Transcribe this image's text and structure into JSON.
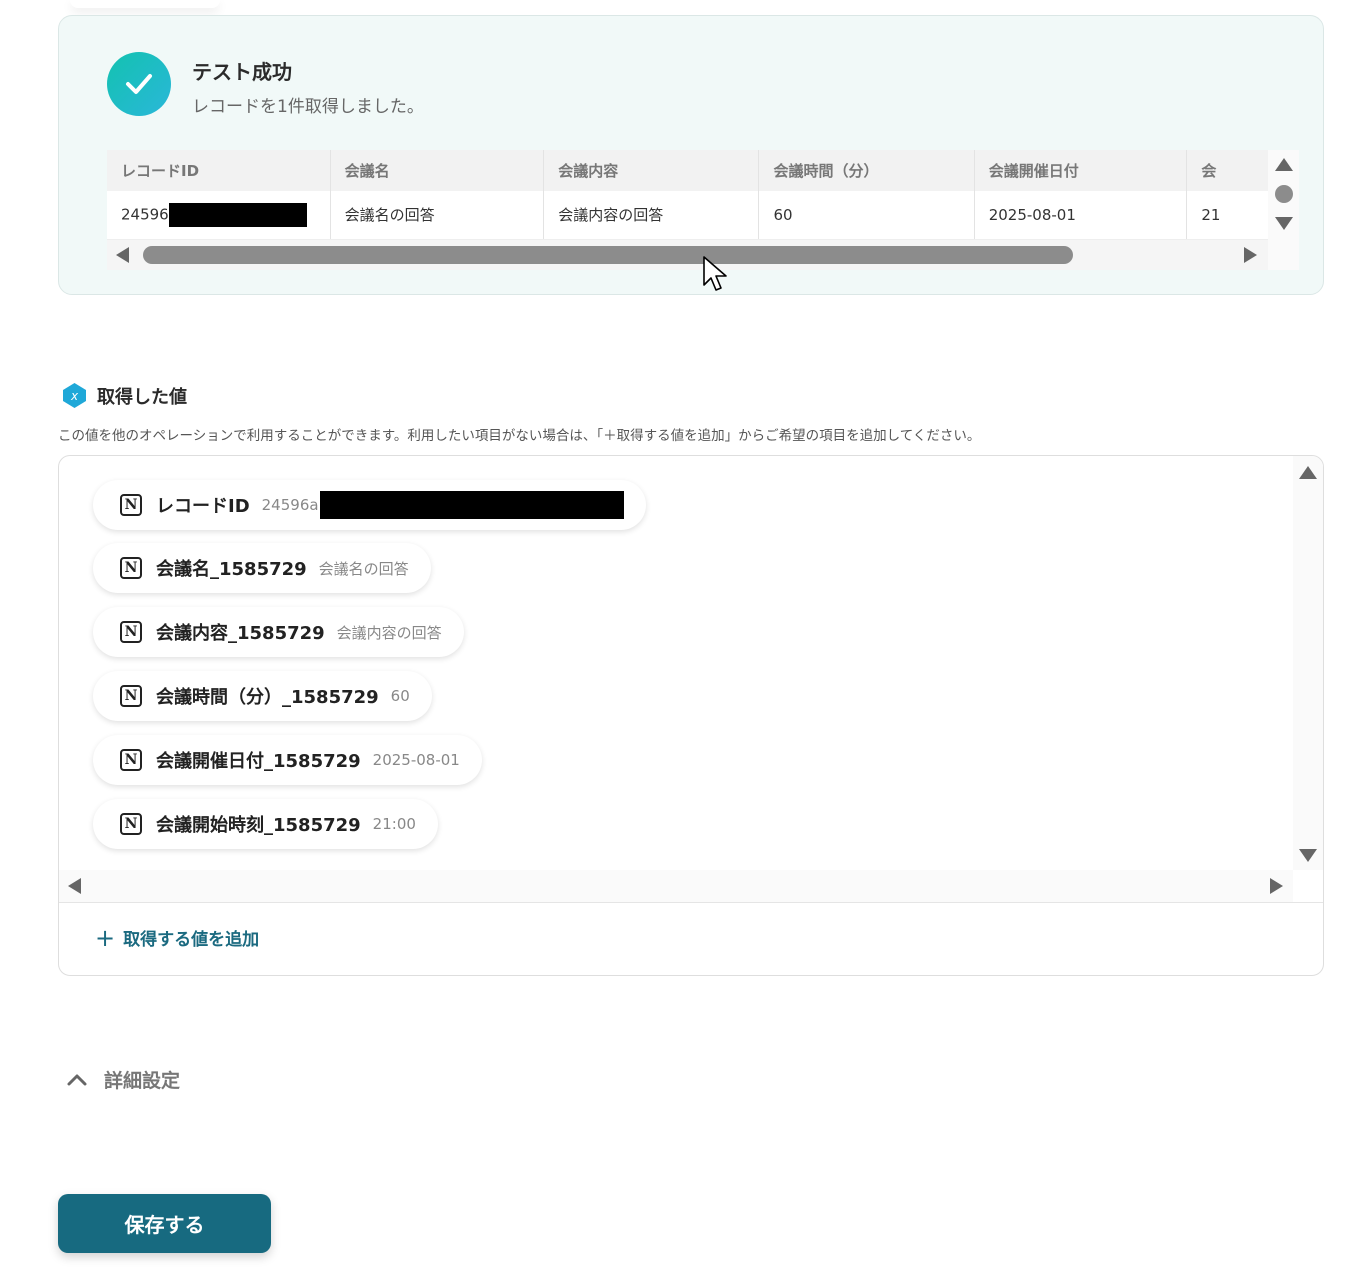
{
  "test_result": {
    "title": "テスト成功",
    "subtitle": "レコードを1件取得しました。"
  },
  "record_table": {
    "columns": [
      "レコードID",
      "会議名",
      "会議内容",
      "会議時間（分）",
      "会議開催日付",
      "会"
    ],
    "row": {
      "record_id": "24596",
      "meeting_name": "会議名の回答",
      "meeting_content": "会議内容の回答",
      "meeting_minutes": "60",
      "meeting_date": "2025-08-01",
      "next_partial": "21"
    }
  },
  "acquired_values": {
    "title": "取得した値",
    "description": "この値を他のオペレーションで利用することができます。利用したい項目がない場合は、「＋取得する値を追加」からご希望の項目を追加してください。",
    "items": [
      {
        "name": "レコードID",
        "value": "24596a"
      },
      {
        "name": "会議名_1585729",
        "value": "会議名の回答"
      },
      {
        "name": "会議内容_1585729",
        "value": "会議内容の回答"
      },
      {
        "name": "会議時間（分）_1585729",
        "value": "60"
      },
      {
        "name": "会議開催日付_1585729",
        "value": "2025-08-01"
      },
      {
        "name": "会議開始時刻_1585729",
        "value": "21:00"
      }
    ],
    "add_label": "取得する値を追加"
  },
  "detail_settings": {
    "label": "詳細設定"
  },
  "save_button": {
    "label": "保存する"
  },
  "icons": {
    "check": "check-icon",
    "notion": "notion-icon",
    "variable": "variable-badge-icon",
    "plus": "plus-icon",
    "chevron": "chevron-up-icon"
  },
  "colors": {
    "success_bg": "#f1f9f8",
    "check_gradient_start": "#13c2b0",
    "check_gradient_end": "#2ab7d9",
    "primary": "#176a80",
    "badge": "#1fa8d8"
  }
}
